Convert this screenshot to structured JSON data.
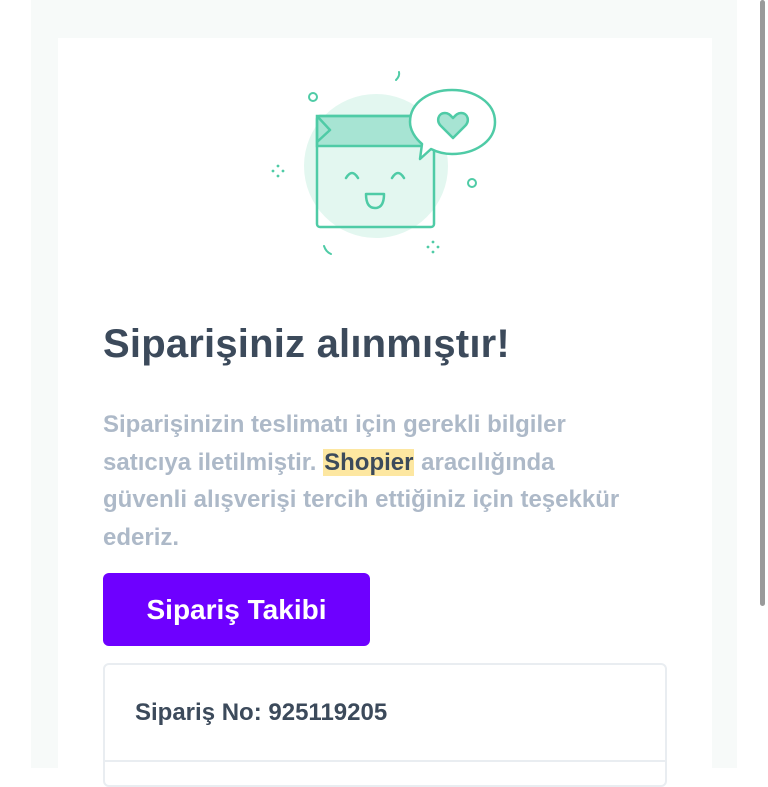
{
  "confirmation": {
    "title": "Siparişiniz alınmıştır!",
    "message_before": "Siparişinizin teslimatı için gerekli bilgiler satıcıya iletilmiştir.",
    "brand": "Shopier",
    "message_after": "aracılığında güvenli alışverişi tercih ettiğiniz için teşekkür ederiz."
  },
  "actions": {
    "track_label": "Sipariş Takibi"
  },
  "order": {
    "number_label": "Sipariş No:",
    "number_value": "925119205"
  },
  "colors": {
    "primary": "#6e00ff",
    "accent_mint": "#4fcba6",
    "highlight": "#fde7a1",
    "heading": "#3c4a5b",
    "muted_text": "#adb9c8"
  },
  "icons": {
    "illustration": "smiling-gift-box-with-heart-bubble"
  }
}
